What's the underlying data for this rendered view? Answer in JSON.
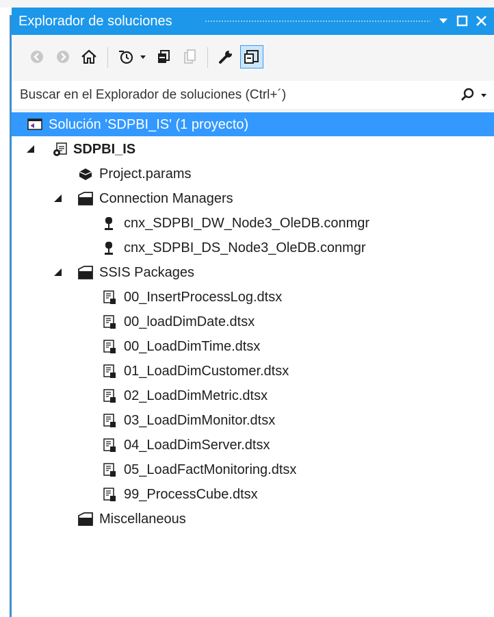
{
  "window": {
    "title": "Explorador de soluciones",
    "accent": "#1c97ea",
    "selection_color": "#3399ff"
  },
  "title_controls": [
    {
      "name": "dropdown",
      "icon": "chevron-down-icon"
    },
    {
      "name": "maximize",
      "icon": "maximize-icon"
    },
    {
      "name": "close",
      "icon": "close-icon"
    }
  ],
  "toolbar": {
    "buttons": [
      {
        "name": "back-button",
        "icon": "back-arrow-icon",
        "enabled": false
      },
      {
        "name": "forward-button",
        "icon": "forward-arrow-icon",
        "enabled": false
      },
      {
        "name": "home-button",
        "icon": "home-icon",
        "enabled": true
      },
      {
        "name": "pending-changes-filter-button",
        "icon": "history-clock-icon",
        "enabled": true,
        "has_dropdown": true
      },
      {
        "name": "collapse-all-button",
        "icon": "collapse-all-icon",
        "enabled": true
      },
      {
        "name": "show-all-files-button",
        "icon": "show-all-files-icon",
        "enabled": false
      },
      {
        "name": "properties-button",
        "icon": "wrench-icon",
        "enabled": true
      },
      {
        "name": "preview-selected-button",
        "icon": "preview-icon",
        "enabled": true,
        "active": true
      }
    ]
  },
  "search": {
    "placeholder": "Buscar en el Explorador de soluciones (Ctrl+´)",
    "icon": "search-icon"
  },
  "tree": {
    "solution": {
      "label": "Solución 'SDPBI_IS'  (1 proyecto)",
      "icon": "solution-icon",
      "selected": true
    },
    "project": {
      "label": "SDPBI_IS",
      "icon": "ssis-project-icon",
      "expanded": true
    },
    "params": {
      "label": "Project.params",
      "icon": "params-icon"
    },
    "connections": {
      "label": "Connection Managers",
      "icon": "folder-icon",
      "expanded": true,
      "items": [
        {
          "label": "cnx_SDPBI_DW_Node3_OleDB.conmgr",
          "icon": "connection-icon"
        },
        {
          "label": "cnx_SDPBI_DS_Node3_OleDB.conmgr",
          "icon": "connection-icon"
        }
      ]
    },
    "packages": {
      "label": "SSIS Packages",
      "icon": "folder-icon",
      "expanded": true,
      "items": [
        {
          "label": "00_InsertProcessLog.dtsx",
          "icon": "package-icon"
        },
        {
          "label": "00_loadDimDate.dtsx",
          "icon": "package-icon"
        },
        {
          "label": "00_LoadDimTime.dtsx",
          "icon": "package-icon"
        },
        {
          "label": "01_LoadDimCustomer.dtsx",
          "icon": "package-icon"
        },
        {
          "label": "02_LoadDimMetric.dtsx",
          "icon": "package-icon"
        },
        {
          "label": "03_LoadDimMonitor.dtsx",
          "icon": "package-icon"
        },
        {
          "label": "04_LoadDimServer.dtsx",
          "icon": "package-icon"
        },
        {
          "label": "05_LoadFactMonitoring.dtsx",
          "icon": "package-icon"
        },
        {
          "label": "99_ProcessCube.dtsx",
          "icon": "package-icon"
        }
      ]
    },
    "misc": {
      "label": "Miscellaneous",
      "icon": "folder-icon"
    }
  }
}
